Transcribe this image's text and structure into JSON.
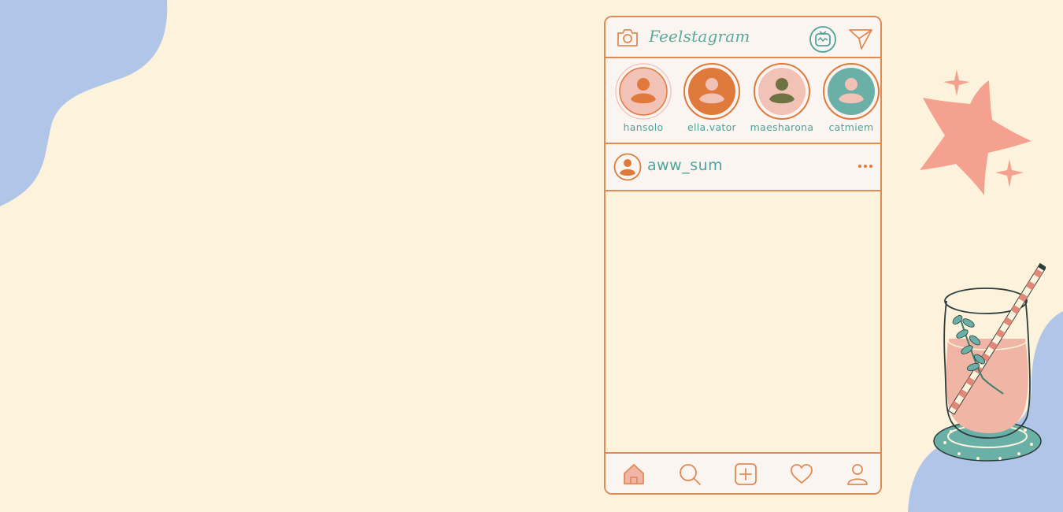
{
  "app": {
    "title": "Feelstagram"
  },
  "icons": {
    "camera": "camera-icon",
    "igtv": "igtv-icon",
    "direct": "send-icon",
    "more": "more-icon",
    "nav": [
      "home-icon",
      "search-icon",
      "add-post-icon",
      "heart-icon",
      "profile-icon"
    ]
  },
  "stories": [
    {
      "username": "hansolo",
      "ring": "#f2c8c0",
      "bg": "#f2c2b6",
      "figure": "#e07a3c",
      "head": "#e07a3c"
    },
    {
      "username": "ella.vator",
      "ring": "#e07a3c",
      "bg": "#e07a3c",
      "figure": "#f2c2b6",
      "head": "#f2c2b6"
    },
    {
      "username": "maesharona",
      "ring": "#e07a3c",
      "bg": "#f2c2b6",
      "figure": "#6f7341",
      "head": "#6f7341"
    },
    {
      "username": "catmiem",
      "ring": "#e07a3c",
      "bg": "#6bb0a7",
      "figure": "#f2c2b6",
      "head": "#f2c2b6"
    }
  ],
  "post": {
    "username": "aww_sum"
  },
  "colors": {
    "background": "#fdf3dc",
    "accent": "#e08a55",
    "teal": "#4ea39a",
    "blob": "#b1c5e8",
    "star": "#f5a18f"
  }
}
